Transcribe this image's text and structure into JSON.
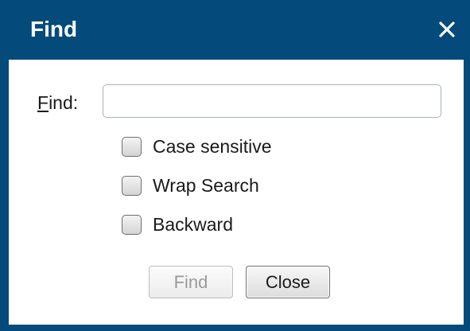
{
  "dialog": {
    "title": "Find",
    "close_icon": "close-icon"
  },
  "find_field": {
    "label": "Find:",
    "label_mnemonic": "F",
    "label_rest": "ind:",
    "value": "",
    "placeholder": ""
  },
  "options": [
    {
      "label": "Case sensitive",
      "checked": false
    },
    {
      "label": "Wrap Search",
      "checked": false
    },
    {
      "label": "Backward",
      "checked": false
    }
  ],
  "buttons": {
    "find_label": "Find",
    "find_enabled": false,
    "close_label": "Close"
  },
  "colors": {
    "titlebar": "#044a7a",
    "title_text": "#ffffff",
    "disabled_text": "#9a9a9a"
  }
}
